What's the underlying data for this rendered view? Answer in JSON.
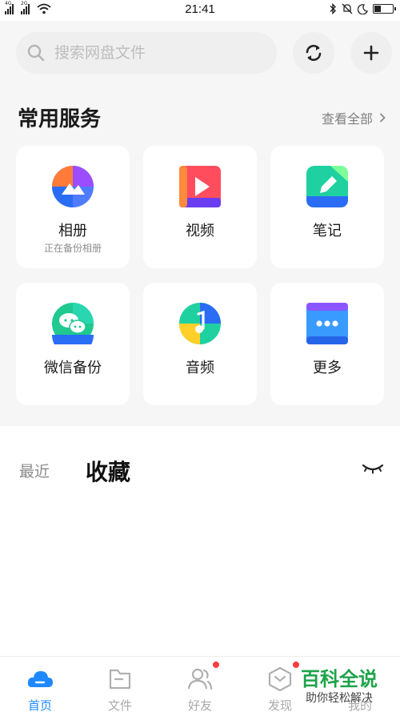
{
  "status_bar": {
    "network_1": "4G",
    "network_2": "2G",
    "time": "21:41"
  },
  "search": {
    "placeholder": "搜索网盘文件"
  },
  "services": {
    "title": "常用服务",
    "view_all": "查看全部",
    "items": [
      {
        "label": "相册",
        "sub": "正在备份相册",
        "icon": "photo-album-icon"
      },
      {
        "label": "视频",
        "sub": "",
        "icon": "video-icon"
      },
      {
        "label": "笔记",
        "sub": "",
        "icon": "notes-icon"
      },
      {
        "label": "微信备份",
        "sub": "",
        "icon": "wechat-backup-icon"
      },
      {
        "label": "音频",
        "sub": "",
        "icon": "audio-icon"
      },
      {
        "label": "更多",
        "sub": "",
        "icon": "more-icon"
      }
    ]
  },
  "tabs": {
    "recent": "最近",
    "favorites": "收藏"
  },
  "bottom_nav": [
    {
      "label": "首页",
      "active": true
    },
    {
      "label": "文件",
      "active": false
    },
    {
      "label": "好友",
      "active": false
    },
    {
      "label": "发现",
      "active": false
    },
    {
      "label": "我的",
      "active": false
    }
  ],
  "watermark": {
    "main": "百科全说",
    "sub": "助你轻松解决"
  },
  "colors": {
    "accent": "#1e88ff",
    "badge": "#ff3b3b",
    "watermark": "#1ea34a"
  }
}
